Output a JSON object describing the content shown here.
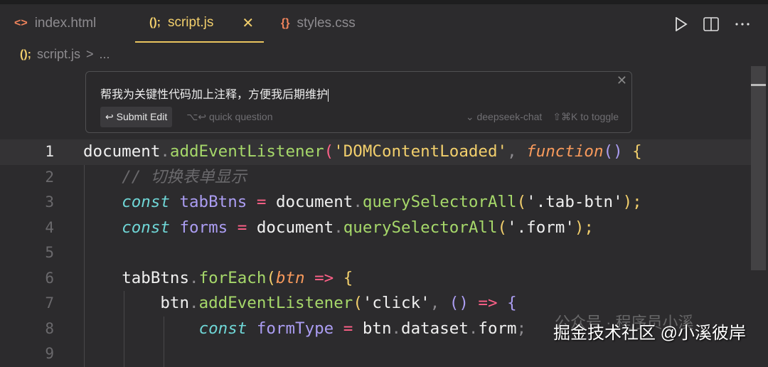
{
  "tabs": [
    {
      "icon": "<>",
      "label": "index.html",
      "color": "#f0845c"
    },
    {
      "icon": "();",
      "label": "script.js",
      "active": true,
      "close": "✕"
    },
    {
      "icon": "{}",
      "label": "styles.css",
      "color": "#f0845c"
    }
  ],
  "breadcrumb": {
    "icon": "();",
    "file": "script.js",
    "sep": ">",
    "more": "..."
  },
  "prompt": {
    "text": "帮我为关键性代码加上注释，方便我后期维护",
    "submit": "↩ Submit Edit",
    "quick": "⌥↩ quick question",
    "model": "⌄ deepseek-chat",
    "toggle": "⇧⌘K to toggle",
    "close": "✕"
  },
  "code": [
    {
      "n": "1",
      "tokens": [
        [
          "document",
          ""
        ],
        [
          ".",
          "pn"
        ],
        [
          "addEventListener",
          "f"
        ],
        [
          "(",
          "p"
        ],
        [
          "'DOMContentLoaded'",
          "s"
        ],
        [
          ", ",
          "pn"
        ],
        [
          "function",
          "it"
        ],
        [
          "()",
          "v"
        ],
        [
          " {",
          "s"
        ]
      ]
    },
    {
      "n": "2",
      "tokens": [
        [
          "    ",
          ""
        ],
        [
          "// 切换表单显示",
          "c"
        ]
      ]
    },
    {
      "n": "3",
      "tokens": [
        [
          "    ",
          ""
        ],
        [
          "const",
          "k"
        ],
        [
          " ",
          ""
        ],
        [
          "tabBtns",
          "v"
        ],
        [
          " = ",
          "p"
        ],
        [
          "document",
          ""
        ],
        [
          ".",
          "pn"
        ],
        [
          "querySelectorAll",
          "f"
        ],
        [
          "(",
          "s"
        ],
        [
          "'.tab-btn'",
          ""
        ],
        [
          ");",
          "s"
        ]
      ]
    },
    {
      "n": "4",
      "tokens": [
        [
          "    ",
          ""
        ],
        [
          "const",
          "k"
        ],
        [
          " ",
          ""
        ],
        [
          "forms",
          "v"
        ],
        [
          " = ",
          "p"
        ],
        [
          "document",
          ""
        ],
        [
          ".",
          "pn"
        ],
        [
          "querySelectorAll",
          "f"
        ],
        [
          "(",
          "s"
        ],
        [
          "'.form'",
          ""
        ],
        [
          ");",
          "s"
        ]
      ]
    },
    {
      "n": "5",
      "tokens": []
    },
    {
      "n": "6",
      "tokens": [
        [
          "    ",
          ""
        ],
        [
          "tabBtns",
          ""
        ],
        [
          ".",
          "pn"
        ],
        [
          "forEach",
          "f"
        ],
        [
          "(",
          "s"
        ],
        [
          "btn",
          "it"
        ],
        [
          " => ",
          "p"
        ],
        [
          "{",
          "s"
        ]
      ]
    },
    {
      "n": "7",
      "tokens": [
        [
          "        ",
          ""
        ],
        [
          "btn",
          ""
        ],
        [
          ".",
          "pn"
        ],
        [
          "addEventListener",
          "f"
        ],
        [
          "(",
          "s"
        ],
        [
          "'click'",
          ""
        ],
        [
          ", ",
          "pn"
        ],
        [
          "()",
          "v"
        ],
        [
          " => ",
          "p"
        ],
        [
          "{",
          "v"
        ]
      ]
    },
    {
      "n": "8",
      "tokens": [
        [
          "            ",
          ""
        ],
        [
          "const",
          "k"
        ],
        [
          " ",
          ""
        ],
        [
          "formType",
          "v"
        ],
        [
          " = ",
          "p"
        ],
        [
          "btn",
          ""
        ],
        [
          ".",
          "pn"
        ],
        [
          "dataset",
          ""
        ],
        [
          ".",
          "pn"
        ],
        [
          "form",
          ""
        ],
        [
          ";",
          "pn"
        ]
      ]
    },
    {
      "n": "9",
      "tokens": []
    }
  ],
  "watermark": {
    "line1": "公众号 · 程序员小溪",
    "line2": "掘金技术社区 @小溪彼岸"
  }
}
